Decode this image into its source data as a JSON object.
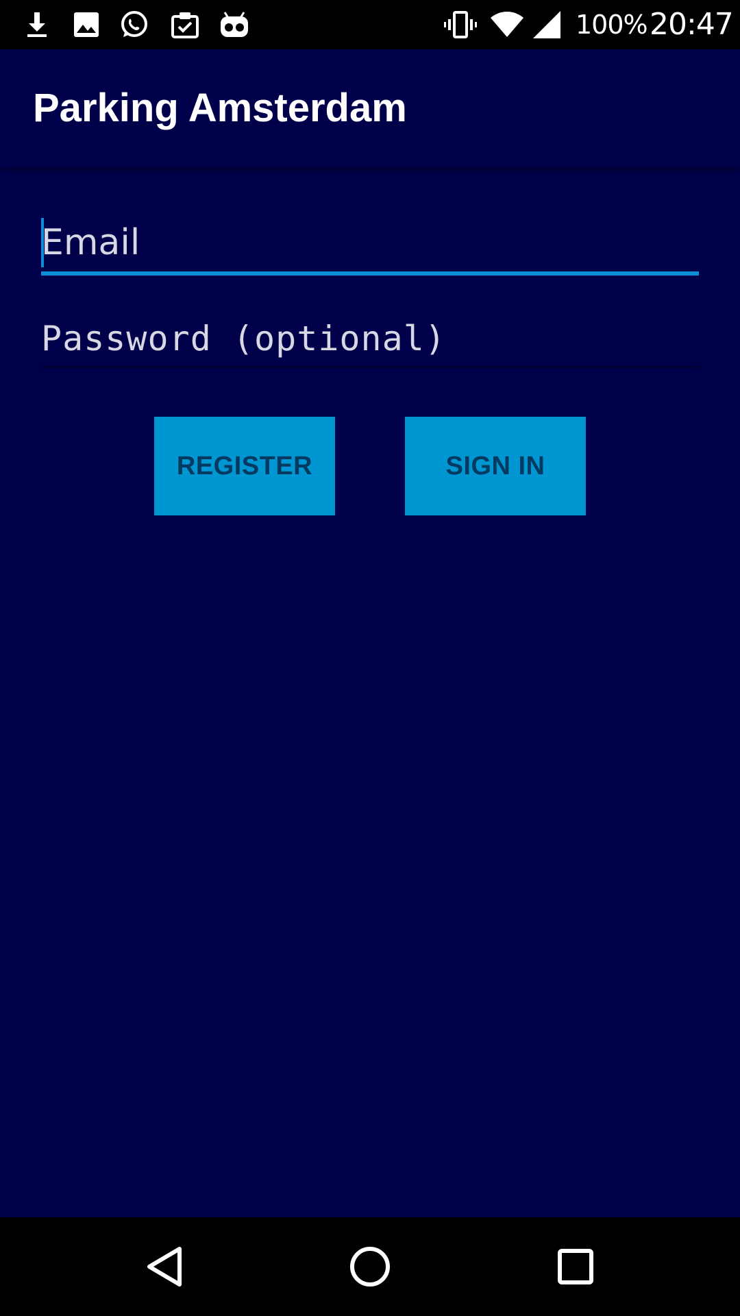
{
  "status_bar": {
    "left_icons": [
      "download-icon",
      "image-icon",
      "whatsapp-icon",
      "clipboard-check-icon",
      "voicemail-robot-icon"
    ],
    "right_icons": [
      "vibrate-icon",
      "wifi-icon",
      "cell-signal-icon"
    ],
    "battery": "100%",
    "time": "20:47"
  },
  "app_bar": {
    "title": "Parking Amsterdam"
  },
  "form": {
    "email": {
      "placeholder": "Email",
      "value": ""
    },
    "password": {
      "placeholder": "Password (optional)",
      "value": ""
    },
    "register_label": "REGISTER",
    "signin_label": "SIGN IN"
  },
  "nav_bar": {
    "icons": [
      "back-icon",
      "home-icon",
      "recents-icon"
    ]
  },
  "colors": {
    "background": "#00004a",
    "accent": "#0a8fd6",
    "button": "#0096d1",
    "button_text": "#043a62"
  }
}
